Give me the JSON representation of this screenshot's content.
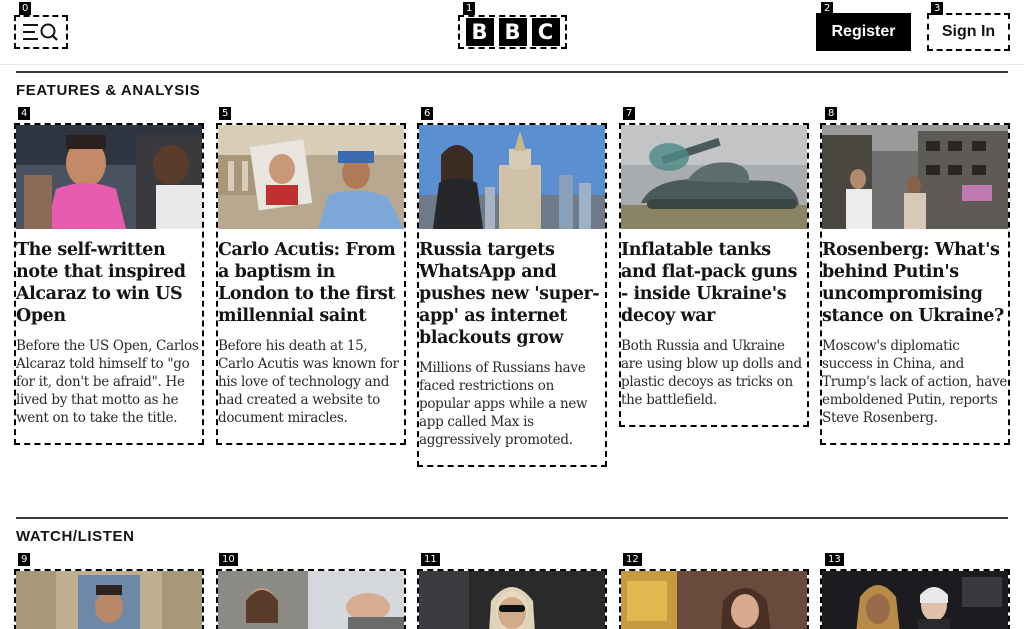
{
  "header": {
    "menu_icon": "menu-search-icon",
    "logo_letters": [
      "B",
      "B",
      "C"
    ],
    "register_label": "Register",
    "signin_label": "Sign In"
  },
  "tags": [
    "0",
    "1",
    "2",
    "3",
    "4",
    "5",
    "6",
    "7",
    "8",
    "9",
    "10",
    "11",
    "12",
    "13"
  ],
  "features": {
    "title": "FEATURES & ANALYSIS",
    "cards": [
      {
        "headline": "The self-written note that inspired Alcaraz to win US Open",
        "summary": "Before the US Open, Carlos Alcaraz told himself to \"go for it, don't be afraid\". He lived by that motto as he went on to take the title."
      },
      {
        "headline": "Carlo Acutis: From a baptism in London to the first millennial saint",
        "summary": "Before his death at 15, Carlo Acutis was known for his love of technology and had created a website to document miracles."
      },
      {
        "headline": "Russia targets WhatsApp and pushes new 'super-app' as internet blackouts grow",
        "summary": "Millions of Russians have faced restrictions on popular apps while a new app called Max is aggressively promoted."
      },
      {
        "headline": "Inflatable tanks and flat-pack guns - inside Ukraine's decoy war",
        "summary": "Both Russia and Ukraine are using blow up dolls and plastic decoys as tricks on the battlefield."
      },
      {
        "headline": "Rosenberg: What's behind Putin's uncompromising stance on Ukraine?",
        "summary": "Moscow's diplomatic success in China, and Trump's lack of action, have emboldened Putin, reports Steve Rosenberg."
      }
    ]
  },
  "watch": {
    "title": "WATCH/LISTEN"
  }
}
